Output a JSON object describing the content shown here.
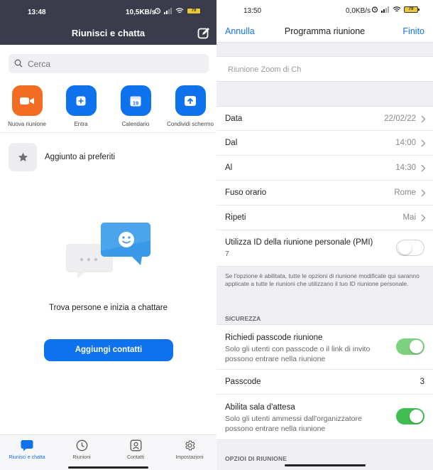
{
  "left": {
    "status": {
      "time": "13:48",
      "net": "10,5KB/s",
      "battery": "79"
    },
    "header": {
      "title": "Riunisci e chatta"
    },
    "search": {
      "placeholder": "Cerca"
    },
    "quick_actions": [
      {
        "label": "Nuova riunione",
        "color": "#f26d21",
        "icon": "video-camera-icon"
      },
      {
        "label": "Entra",
        "color": "#0e72ed",
        "icon": "plus-icon"
      },
      {
        "label": "Calendario",
        "color": "#0e72ed",
        "icon": "calendar-icon",
        "badge": "19"
      },
      {
        "label": "Condividi schermo",
        "color": "#0e72ed",
        "icon": "upload-arrow-icon"
      }
    ],
    "starred": {
      "label": "Aggiunto ai preferiti"
    },
    "empty_state": {
      "text": "Trova persone e inizia a chattare"
    },
    "add_contacts_button": "Aggiungi contatti",
    "tabs": [
      {
        "label": "Riunisci e chatta",
        "icon": "chat-bubble-icon",
        "active": true
      },
      {
        "label": "Riunioni",
        "icon": "clock-icon",
        "active": false
      },
      {
        "label": "Contatti",
        "icon": "contact-card-icon",
        "active": false
      },
      {
        "label": "Impostazioni",
        "icon": "gear-icon",
        "active": false
      }
    ]
  },
  "right": {
    "status": {
      "time": "13:50",
      "net": "0,0KB/s",
      "battery": "79"
    },
    "nav": {
      "cancel": "Annulla",
      "title": "Programma riunione",
      "done": "Finito"
    },
    "topic_value": "Riunione Zoom di Ch",
    "rows": [
      {
        "key": "Data",
        "value": "22/02/22"
      },
      {
        "key": "Dal",
        "value": "14:00"
      },
      {
        "key": "Al",
        "value": "14:30"
      },
      {
        "key": "Fuso orario",
        "value": "Rome"
      },
      {
        "key": "Ripeti",
        "value": "Mai"
      }
    ],
    "pmi": {
      "label": "Utilizza ID della riunione personale (PMI)",
      "sub": "7",
      "enabled": false
    },
    "pmi_note": "Se l'opzione è abilitata, tutte le opzioni di riunione modificate qui saranno applicate a tutte le riunioni che utilizzano il tuo ID riunione personale.",
    "security_header": "SICUREZZA",
    "passcode_required": {
      "label": "Richiedi passcode riunione",
      "sub": "Solo gli utenti con passcode o il link di invito possono entrare nella riunione",
      "enabled": true
    },
    "passcode": {
      "label": "Passcode",
      "value": "3"
    },
    "waiting_room": {
      "label": "Abilita sala d'attesa",
      "sub": "Solo gli utenti ammessi dall'organizzatore possono entrare nella riunione",
      "enabled": true
    },
    "options_header": "OPZIOI DI RIUNIONE"
  }
}
